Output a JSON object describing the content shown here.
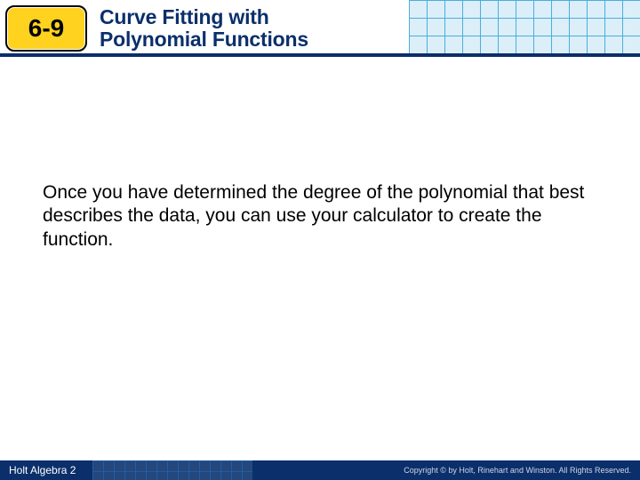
{
  "header": {
    "section_number": "6-9",
    "title_line1": "Curve Fitting with",
    "title_line2": "Polynomial Functions"
  },
  "body": {
    "paragraph": "Once you have determined the degree of the polynomial that best describes the data, you can use your calculator to create the function."
  },
  "footer": {
    "book_title": "Holt Algebra 2",
    "copyright": "Copyright © by Holt, Rinehart and Winston. All Rights Reserved."
  }
}
